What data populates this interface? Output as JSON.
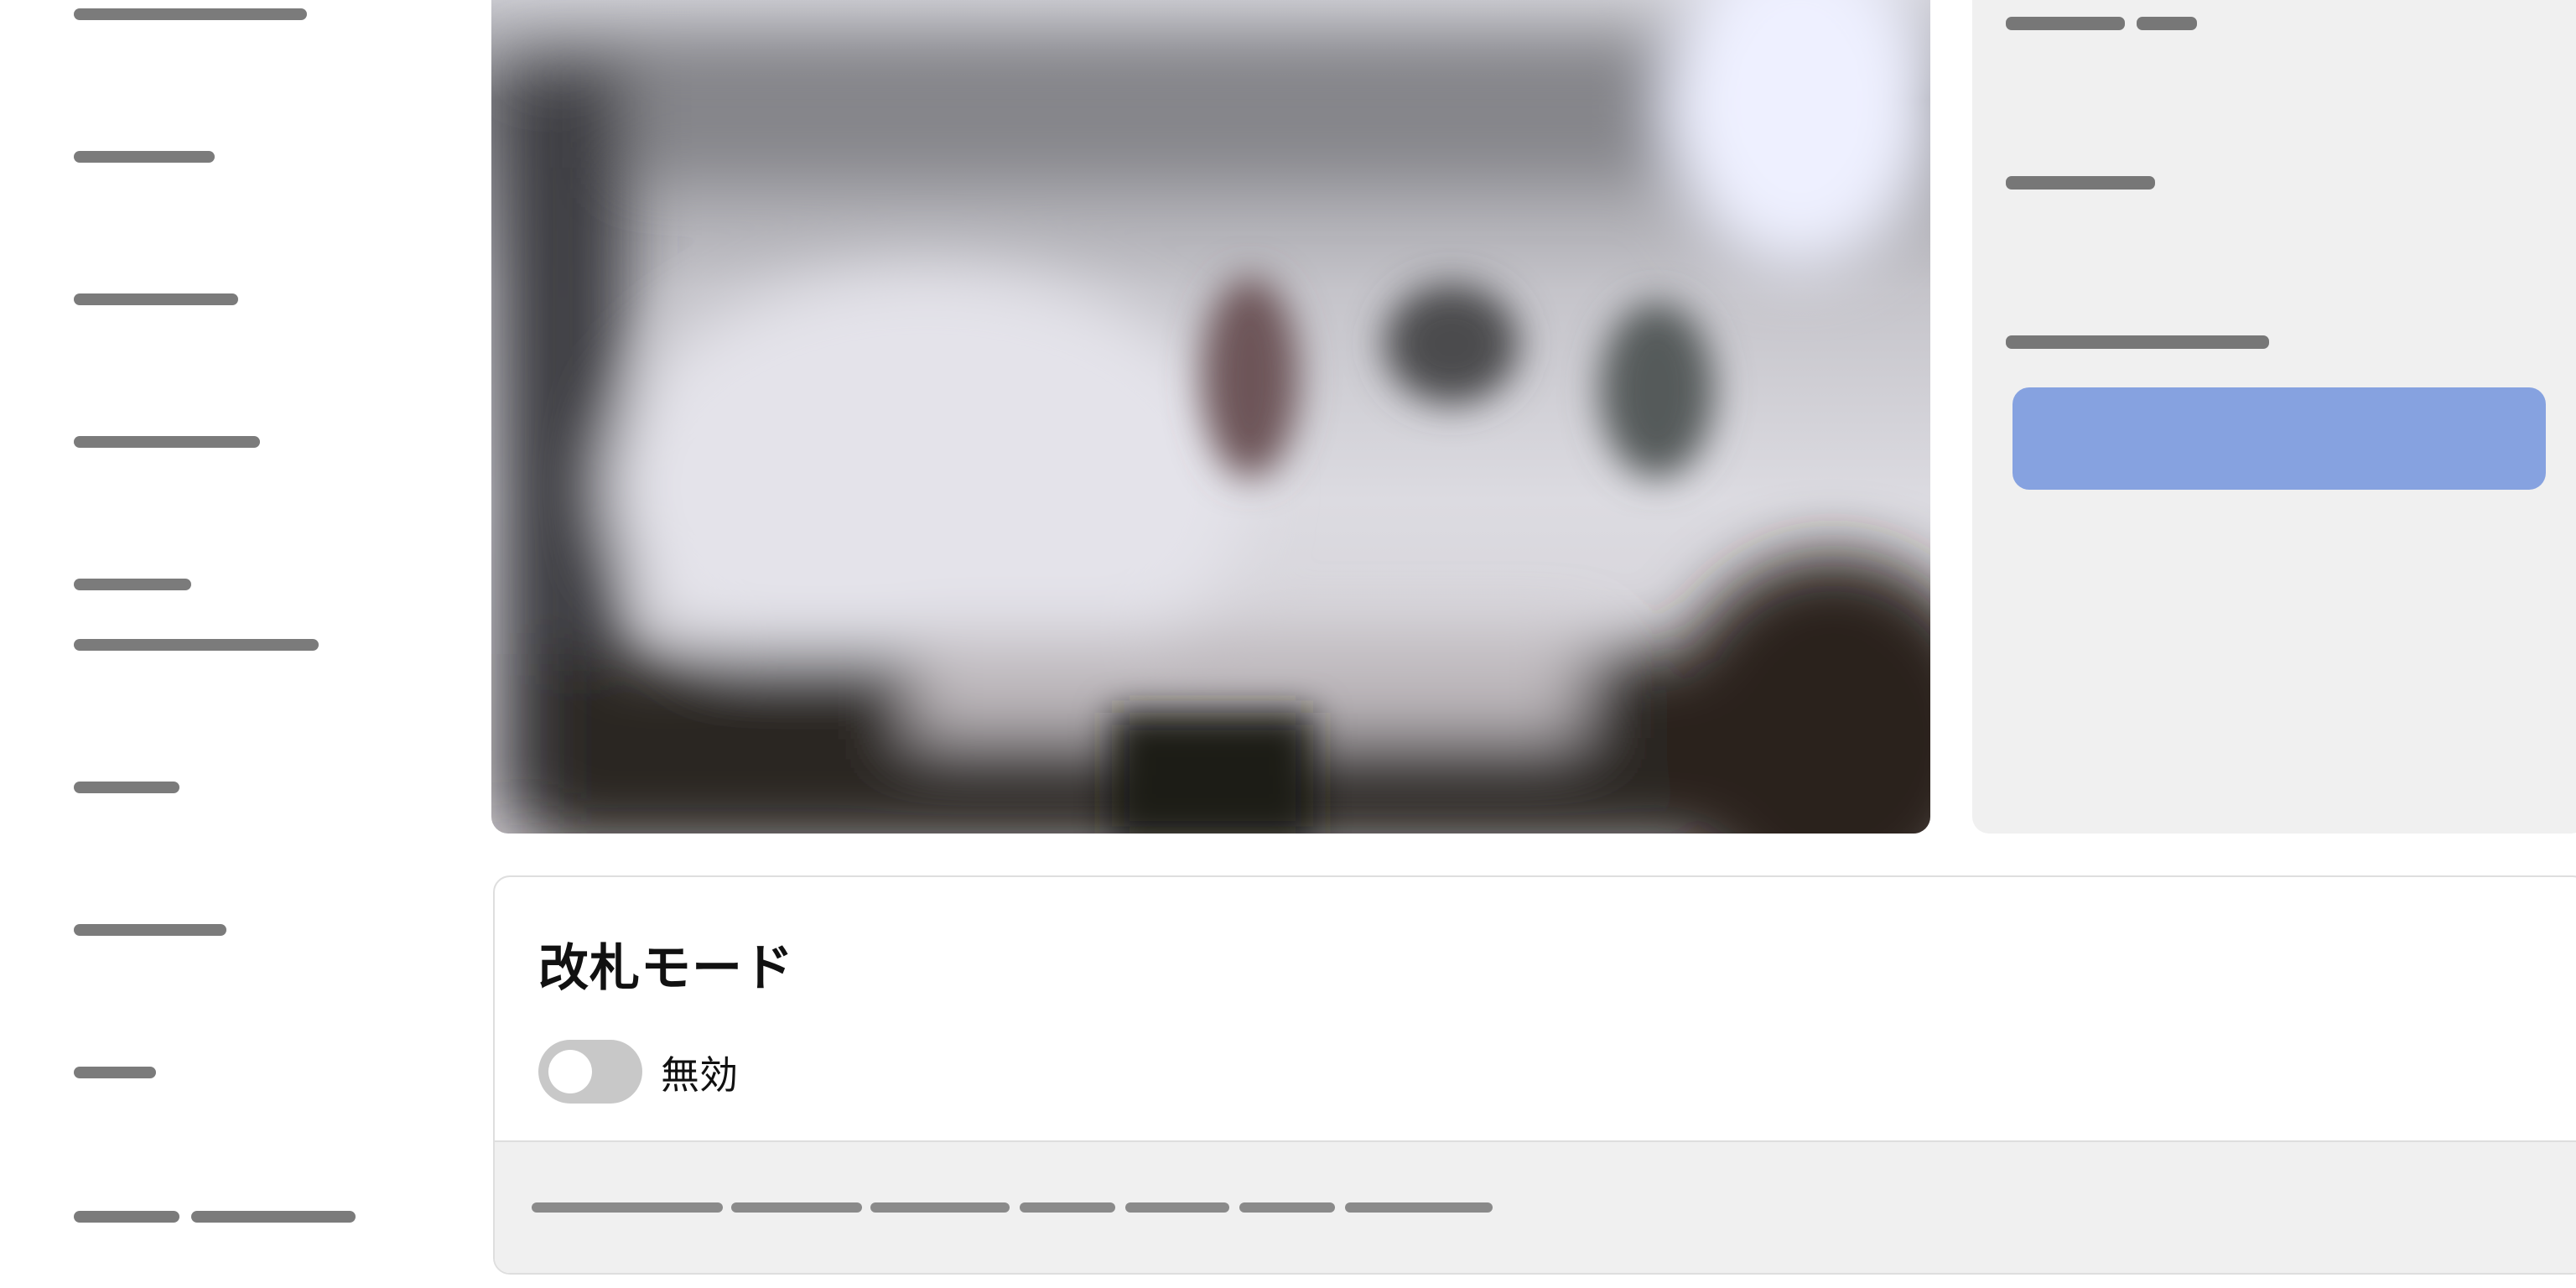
{
  "sidebar": {
    "items": [
      {
        "name": "sidebar-item-1"
      },
      {
        "name": "sidebar-item-2"
      },
      {
        "name": "sidebar-item-3"
      },
      {
        "name": "sidebar-item-4"
      },
      {
        "name": "sidebar-item-5"
      },
      {
        "name": "sidebar-item-6"
      },
      {
        "name": "sidebar-item-7"
      },
      {
        "name": "sidebar-item-8"
      },
      {
        "name": "sidebar-item-9"
      }
    ]
  },
  "media": {
    "icon": "blurred-camera-image"
  },
  "right_panel": {
    "button_color": "#86a2e0"
  },
  "ticket_gate": {
    "title": "改札モード",
    "toggle_state": "off",
    "status_label": "無効"
  },
  "colors": {
    "placeholder_text": "#7b7b7b",
    "panel_background": "#f0f0f0",
    "toggle_off": "#c8c8c8"
  }
}
